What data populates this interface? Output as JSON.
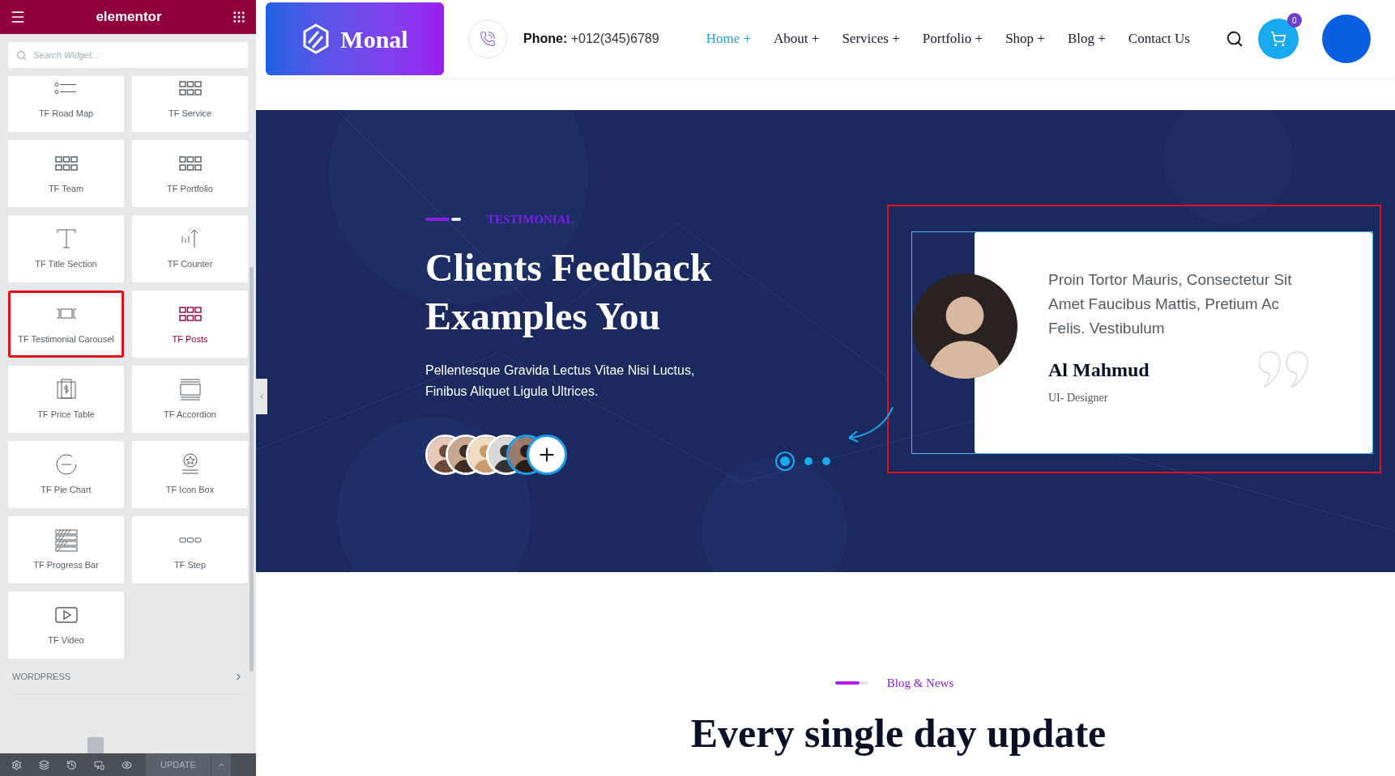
{
  "editor": {
    "brand": "elementor",
    "search": {
      "placeholder": "Search Widget..."
    },
    "widgets": [
      {
        "label": "TF Road Map",
        "kind": "roadmap",
        "selected": false,
        "hovered": false
      },
      {
        "label": "TF Service",
        "kind": "grid",
        "selected": false,
        "hovered": false
      },
      {
        "label": "TF Team",
        "kind": "grid",
        "selected": false,
        "hovered": false
      },
      {
        "label": "TF Portfolio",
        "kind": "grid",
        "selected": false,
        "hovered": false
      },
      {
        "label": "TF Title Section",
        "kind": "title",
        "selected": false,
        "hovered": false
      },
      {
        "label": "TF Counter",
        "kind": "counter",
        "selected": false,
        "hovered": false
      },
      {
        "label": "TF Testimonial Carousel",
        "kind": "carousel",
        "selected": true,
        "hovered": false
      },
      {
        "label": "TF Posts",
        "kind": "grid",
        "selected": false,
        "hovered": true
      },
      {
        "label": "TF Price Table",
        "kind": "price",
        "selected": false,
        "hovered": false
      },
      {
        "label": "TF Accordion",
        "kind": "accordion",
        "selected": false,
        "hovered": false
      },
      {
        "label": "TF Pie Chart",
        "kind": "pie",
        "selected": false,
        "hovered": false
      },
      {
        "label": "TF Icon Box",
        "kind": "iconbox",
        "selected": false,
        "hovered": false
      },
      {
        "label": "TF Progress Bar",
        "kind": "progress",
        "selected": false,
        "hovered": false
      },
      {
        "label": "TF Step",
        "kind": "step",
        "selected": false,
        "hovered": false
      },
      {
        "label": "TF Video",
        "kind": "video",
        "selected": false,
        "hovered": false
      }
    ],
    "category": "WORDPRESS",
    "update_button": "UPDATE"
  },
  "header": {
    "logo": "Monal",
    "phone_label": "Phone:",
    "phone": "+012(345)6789",
    "nav": [
      {
        "label": "Home +",
        "selected": true
      },
      {
        "label": "About +",
        "selected": false
      },
      {
        "label": "Services +",
        "selected": false
      },
      {
        "label": "Portfolio +",
        "selected": false
      },
      {
        "label": "Shop +",
        "selected": false
      },
      {
        "label": "Blog +",
        "selected": false
      },
      {
        "label": "Contact Us",
        "selected": false
      }
    ],
    "cart_count": "0"
  },
  "testimonial": {
    "eyebrow": "TESTIMONIAL",
    "title": "Clients Feedback Examples You",
    "text": "Pellentesque Gravida Lectus Vitae Nisi Luctus, Finibus Aliquet Ligula Ultrices.",
    "dots": [
      {
        "selected": true
      },
      {
        "selected": false
      },
      {
        "selected": false
      }
    ],
    "card": {
      "highlighted": true,
      "quote": "Proin Tortor Mauris, Consectetur Sit Amet Faucibus Mattis, Pretium Ac Felis. Vestibulum",
      "name": "Al Mahmud",
      "role": "UI- Designer"
    }
  },
  "blog": {
    "eyebrow": "Blog & News",
    "title": "Every single day update"
  }
}
